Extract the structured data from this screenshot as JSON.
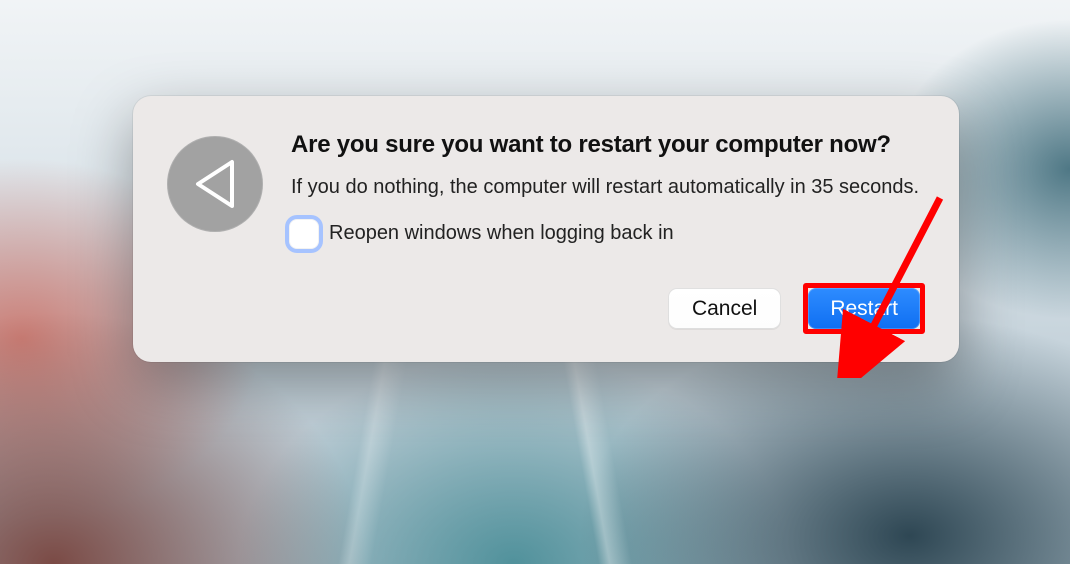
{
  "dialog": {
    "icon": "restart-triangle-icon",
    "title": "Are you sure you want to restart your computer now?",
    "message": "If you do nothing, the computer will restart automatically in 35 seconds.",
    "countdown_seconds": 35,
    "checkbox_label": "Reopen windows when logging back in",
    "checkbox_checked": false,
    "buttons": {
      "cancel": "Cancel",
      "restart": "Restart"
    }
  },
  "annotation": {
    "arrow_color": "#ff0000",
    "highlight_target": "restart-button"
  },
  "colors": {
    "dialog_background": "#ece9e8",
    "primary_button": "#1f7bf6",
    "checkbox_focus_ring": "#a6c3ff",
    "icon_circle": "#a2a2a2",
    "annotation": "#ff0000"
  }
}
